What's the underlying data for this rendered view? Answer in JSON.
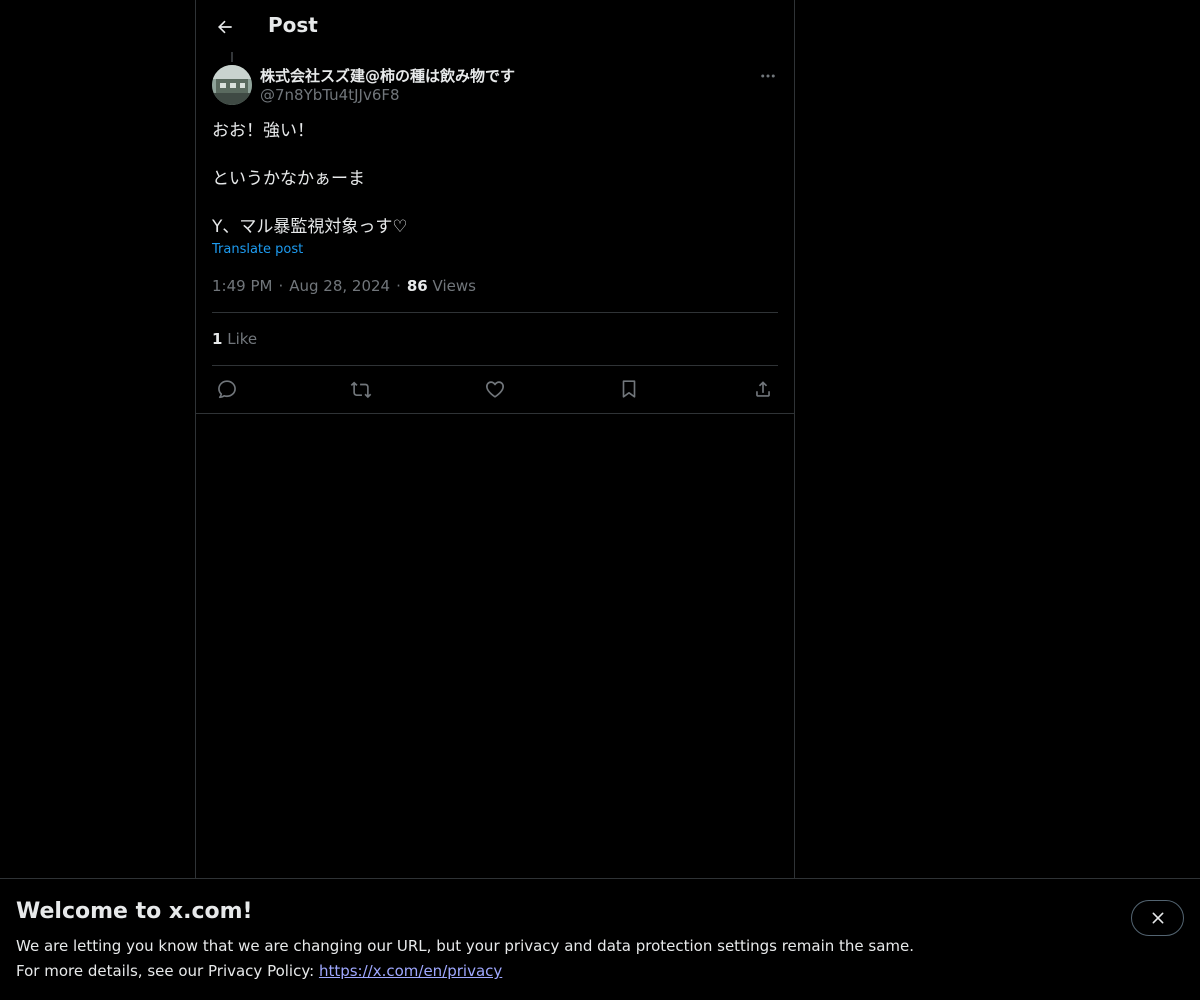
{
  "header": {
    "title": "Post",
    "back_icon": "arrow-left-icon"
  },
  "post": {
    "author": {
      "display_name": "株式会社スズ建@柿の種は飲み物です",
      "handle": "@7n8YbTu4tJJv6F8"
    },
    "text_lines": [
      "おお！強い！",
      "というかなかぁーま",
      "Y、マル暴監視対象っす♡"
    ],
    "translate_label": "Translate post",
    "time": "1:49 PM",
    "date": "Aug 28, 2024",
    "dot": "·",
    "views_count": "86",
    "views_label": "Views",
    "likes_count": "1",
    "likes_label": "Like",
    "action_icons": [
      "reply-icon",
      "repost-icon",
      "like-icon",
      "bookmark-icon",
      "share-icon"
    ]
  },
  "banner": {
    "title": "Welcome to x.com!",
    "line1": "We are letting you know that we are changing our URL, but your privacy and data protection settings remain the same.",
    "line2_prefix": "For more details, see our Privacy Policy: ",
    "link_text": "https://x.com/en/privacy"
  },
  "colors": {
    "background": "#000000",
    "text_primary": "#e7e9ea",
    "text_secondary": "#71767b",
    "accent": "#1d9bf0",
    "border": "#2f3336"
  }
}
